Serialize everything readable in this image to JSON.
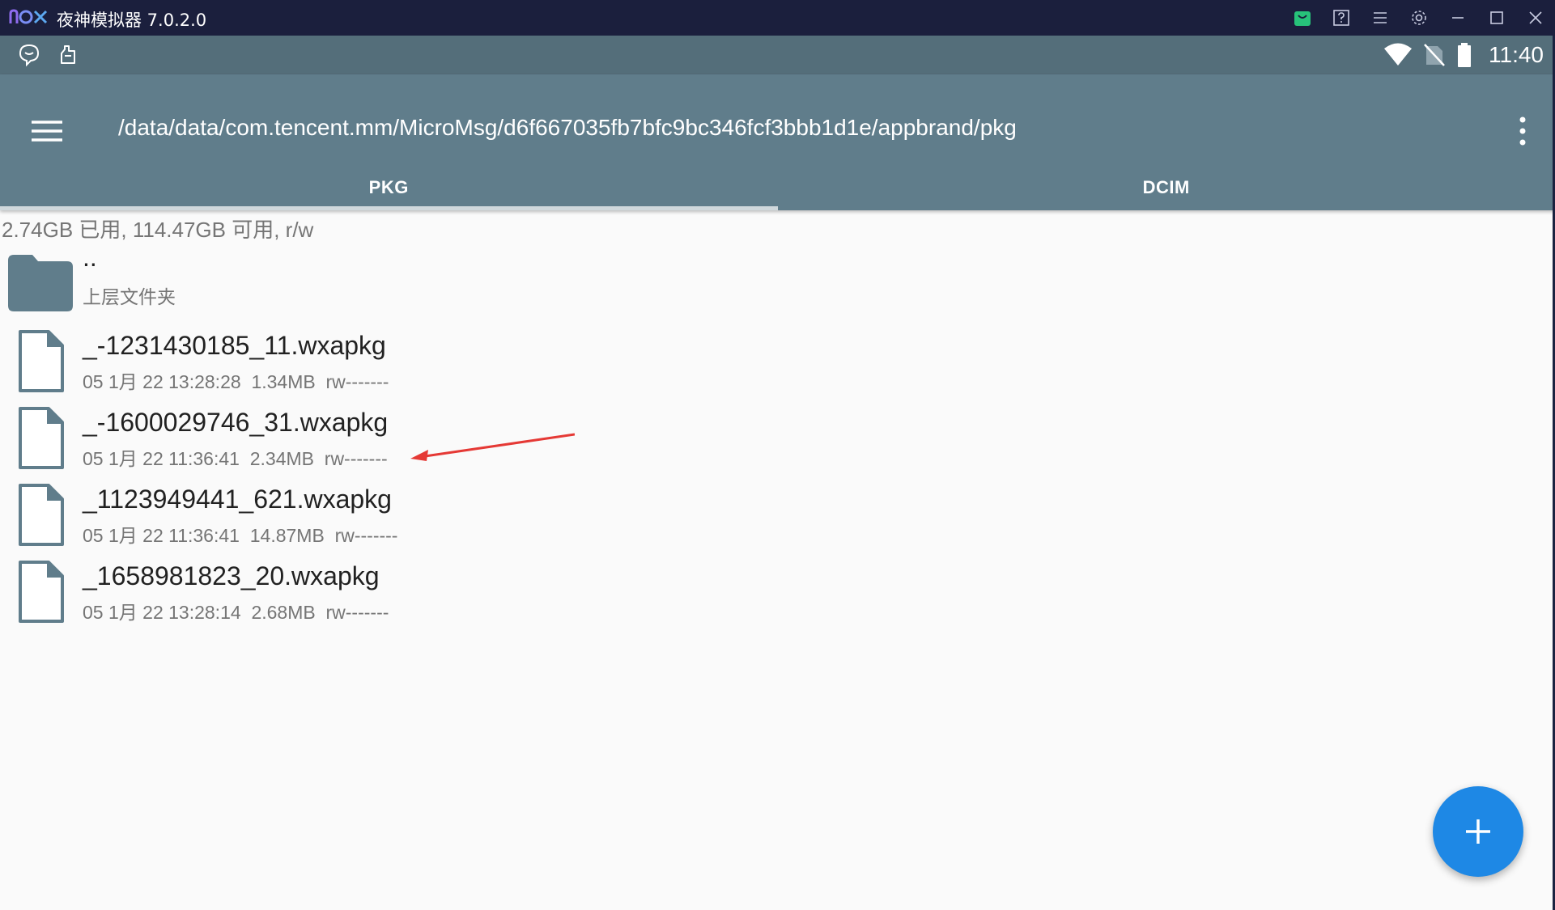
{
  "window": {
    "logo": "nox",
    "title": "夜神模拟器 7.0.2.0",
    "accent_color": "#1b1f3d",
    "icons": [
      "shop-icon",
      "help-icon",
      "menu-icon",
      "settings-icon",
      "minimize-icon",
      "maximize-icon",
      "close-icon"
    ]
  },
  "statusbar": {
    "left_icons": [
      "chat-bubble-icon",
      "hand-icon"
    ],
    "right_icons": [
      "wifi-icon",
      "no-sim-icon",
      "battery-icon"
    ],
    "time": "11:40"
  },
  "appbar": {
    "color": "#607d8b",
    "path": "/data/data/com.tencent.mm/MicroMsg/d6f667035fb7bfc9bc346fcf3bbb1d1e/appbrand/pkg",
    "tabs": [
      {
        "label": "PKG",
        "active": true
      },
      {
        "label": "DCIM",
        "active": false
      }
    ]
  },
  "storage": "2.74GB 已用, 114.47GB 可用, r/w",
  "parent_folder": {
    "name": "..",
    "label": "上层文件夹"
  },
  "files": [
    {
      "name": "_-1231430185_11.wxapkg",
      "date": "05 1月 22 13:28:28",
      "size": "1.34MB",
      "perm": "rw-------"
    },
    {
      "name": "_-1600029746_31.wxapkg",
      "date": "05 1月 22 11:36:41",
      "size": "2.34MB",
      "perm": "rw-------"
    },
    {
      "name": "_1123949441_621.wxapkg",
      "date": "05 1月 22 11:36:41",
      "size": "14.87MB",
      "perm": "rw-------"
    },
    {
      "name": "_1658981823_20.wxapkg",
      "date": "05 1月 22 13:28:14",
      "size": "2.68MB",
      "perm": "rw-------"
    }
  ],
  "fab": {
    "icon": "plus-icon",
    "color": "#1e88e5"
  },
  "annotation": {
    "type": "arrow",
    "color": "#e53935"
  }
}
